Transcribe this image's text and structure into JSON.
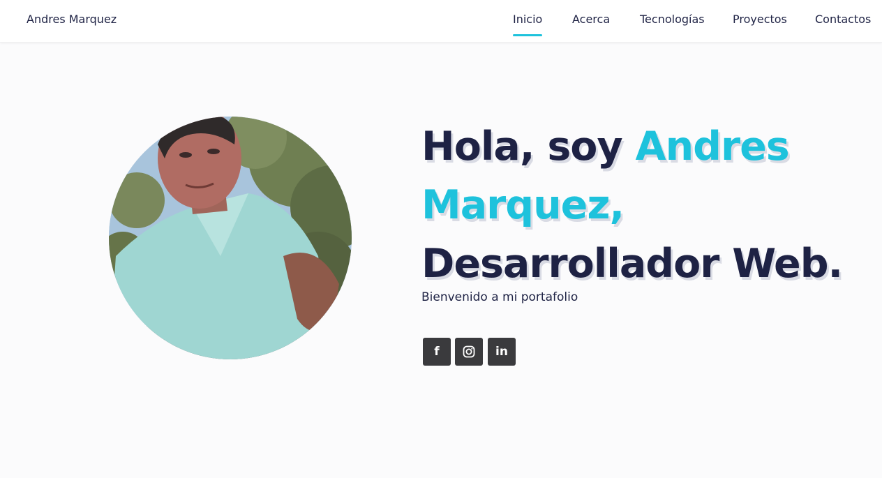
{
  "header": {
    "brand": "Andres Marquez",
    "nav": [
      {
        "label": "Inicio",
        "active": true
      },
      {
        "label": "Acerca",
        "active": false
      },
      {
        "label": "Tecnologías",
        "active": false
      },
      {
        "label": "Proyectos",
        "active": false
      },
      {
        "label": "Contactos",
        "active": false
      }
    ]
  },
  "hero": {
    "greeting": "Hola, soy",
    "name_first": "Andres",
    "name_last": "Marquez,",
    "role": "Desarrollador Web.",
    "subtitle": "Bienvenido a mi portafolio",
    "photo": "profile-photo",
    "social": [
      {
        "icon": "facebook-icon",
        "glyph": "f"
      },
      {
        "icon": "instagram-icon",
        "glyph": ""
      },
      {
        "icon": "linkedin-icon",
        "glyph": "in"
      }
    ]
  },
  "colors": {
    "accent": "#1ec2dc",
    "text": "#1e2244",
    "background": "#fbfbfc",
    "social_bg": "#3a3a3d"
  }
}
